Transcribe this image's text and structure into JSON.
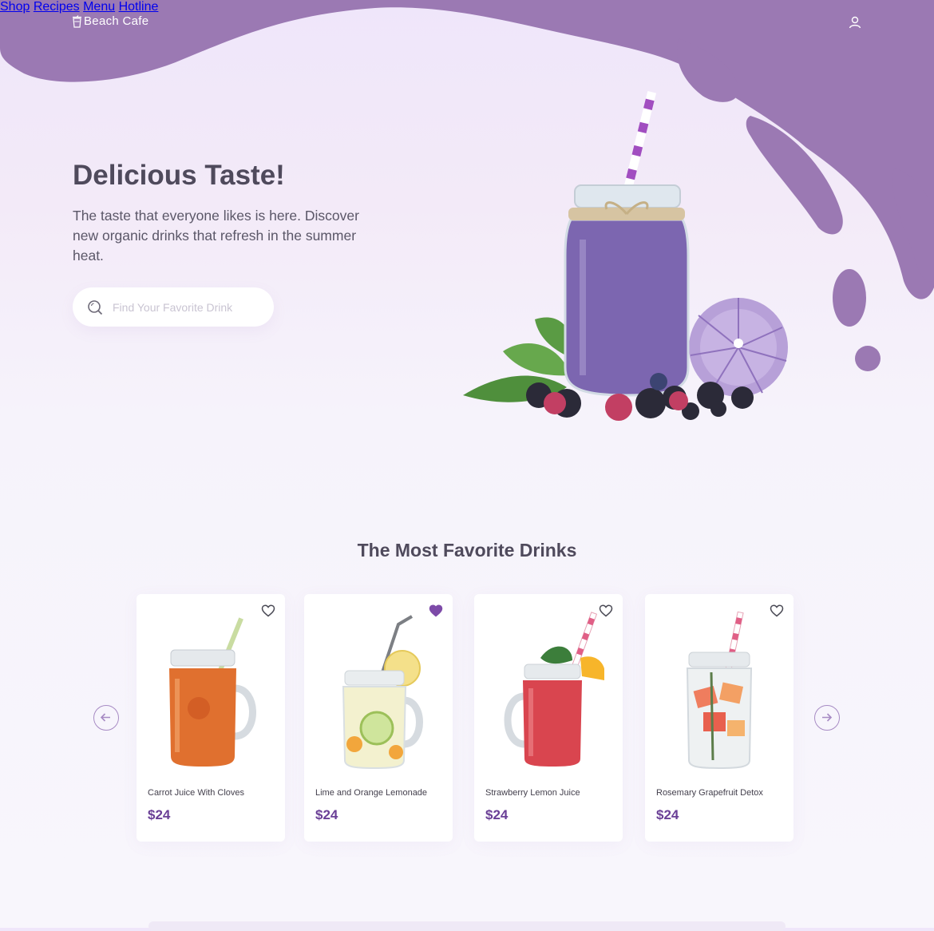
{
  "colors": {
    "accent": "#9b79b3",
    "price": "#6a3f96",
    "heart_filled": "#7d4aa8"
  },
  "nav": {
    "brand": "Beach Cafe",
    "brand_icon": "cup-icon",
    "links": [
      "Shop",
      "Recipes",
      "Menu",
      "Hotline"
    ],
    "user_icon": "user-icon"
  },
  "hero": {
    "title": "Delicious Taste!",
    "text": "The taste that everyone likes is here. Discover new organic drinks that refresh in the summer heat.",
    "search_placeholder": "Find Your Favorite Drink"
  },
  "favorites": {
    "title": "The Most Favorite Drinks",
    "items": [
      {
        "name": "Carrot Juice With Cloves",
        "price": "$24",
        "favorited": false
      },
      {
        "name": "Lime and Orange Lemonade",
        "price": "$24",
        "favorited": true
      },
      {
        "name": "Strawberry Lemon Juice",
        "price": "$24",
        "favorited": false
      },
      {
        "name": "Rosemary Grapefruit Detox",
        "price": "$24",
        "favorited": false
      }
    ]
  }
}
